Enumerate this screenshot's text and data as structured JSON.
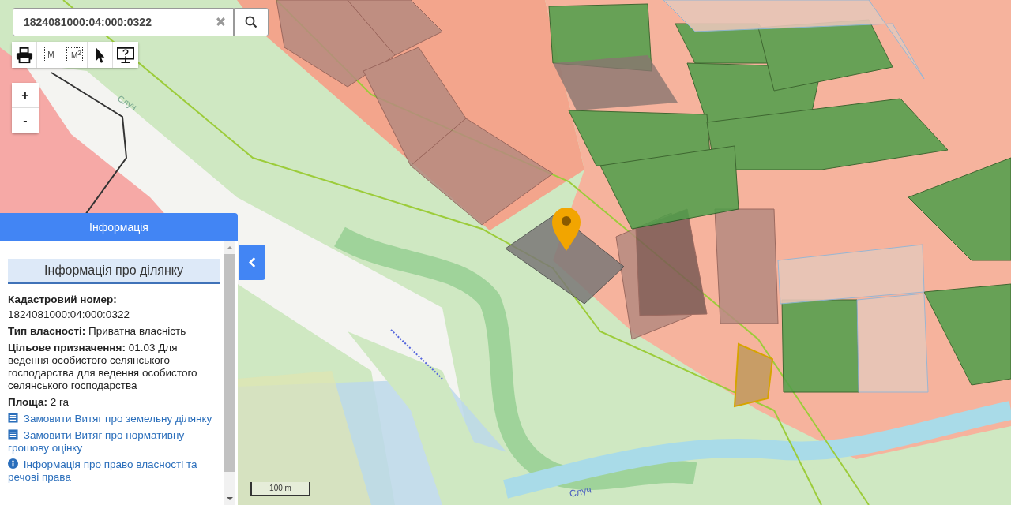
{
  "search": {
    "value": "1824081000:04:000:0322"
  },
  "tools": [
    {
      "kind": "print"
    },
    {
      "kind": "length",
      "label": "M"
    },
    {
      "kind": "area",
      "label": "M$^{2}$"
    },
    {
      "kind": "pointer"
    },
    {
      "kind": "help"
    }
  ],
  "zoom": [
    "+",
    "-"
  ],
  "panel": {
    "title": "Інформація",
    "heading": "Інформація про ділянку",
    "fields": [
      {
        "kind": "stacked",
        "label": "Кадастровий номер:",
        "value": "1824081000:04:000:0322"
      },
      {
        "kind": "inline",
        "label": "Тип власності:",
        "value": "Приватна власність"
      },
      {
        "kind": "inline",
        "label": "Цільове призначення:",
        "value": "01.03 Для ведення особистого селянського господарства для ведення особистого селянського господарства"
      },
      {
        "kind": "inline",
        "label": "Площа:",
        "value": "2 га"
      }
    ],
    "links": [
      {
        "kind": "list",
        "text": "Замовити Витяг про земельну ділянку"
      },
      {
        "kind": "list",
        "text": "Замовити Витяг про нормативну грошову оцінку"
      },
      {
        "kind": "info",
        "text": "Інформація про право власності та речові права"
      }
    ]
  },
  "map": {
    "river_labels": [
      "Случ",
      "Случ"
    ],
    "scale": "100 m"
  }
}
